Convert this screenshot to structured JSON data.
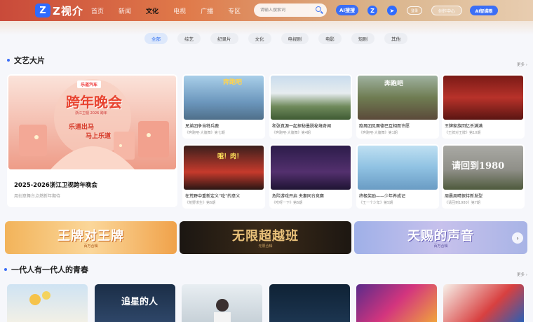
{
  "header": {
    "logo_mark": "Z",
    "logo_text": "Z视介",
    "nav": [
      "首页",
      "新闻",
      "文化",
      "电视",
      "广播",
      "专区"
    ],
    "active_nav": "文化",
    "search_placeholder": "请输入搜索词",
    "ai_search_label": "AI搜搜",
    "login_label": "登录",
    "creator_label": "创作中心",
    "smart_label": "AI智媒眼"
  },
  "filters": [
    "全部",
    "综艺",
    "纪录片",
    "文化",
    "电视剧",
    "电影",
    "短剧",
    "其他"
  ],
  "section1": {
    "title": "文艺大片",
    "more": "更多 ›"
  },
  "feature": {
    "title": "2025-2026浙江卫视跨年晚会",
    "subtitle": "用创意舞台点燃新年期待",
    "poster_brand": "乐道汽车",
    "poster_title": "跨年晚会",
    "poster_date": "浙江卫视 2026 跨年",
    "poster_slogan_1": "乐道出马",
    "poster_slogan_2": "马上乐道"
  },
  "cards": [
    {
      "title": "兄弟团争当特兵鹿",
      "subtitle": "《奔跑吧·大篷舞》第七期",
      "wm": "奔跑吧"
    },
    {
      "title": "和张真源一起探秘墨脱秘境奇闻",
      "subtitle": "《奔跑吧·大篷舞》第4期",
      "wm": ""
    },
    {
      "title": "跑男团见面德巴互相而许愿",
      "subtitle": "《奔跑吧·大篷舞》第1期",
      "wm": "奔跑吧"
    },
    {
      "title": "王牌家族回忆杀满满",
      "subtitle": "《王牌对王牌》第10期",
      "wm": ""
    },
    {
      "title": "在荒野中重新定义“吃”的意义",
      "subtitle": "《荒野求生》第6期",
      "wm": "哦！肉！"
    },
    {
      "title": "危险游戏开启 夫妻同台竞赛",
      "subtitle": "《哎呀一下》第6期",
      "wm": ""
    },
    {
      "title": "终极奖励——少年养成记",
      "subtitle": "《王一个少年》第5期",
      "wm": ""
    },
    {
      "title": "周晨周晴保持新发型",
      "subtitle": "《请回到1980》第7期",
      "wm": "请回到1980"
    }
  ],
  "banners": [
    {
      "title": "王牌对王牌",
      "subtitle": "百万合辑"
    },
    {
      "title": "无限超越班",
      "subtitle": "无限合辑"
    },
    {
      "title": "天赐的声音",
      "subtitle": "百万合辑"
    }
  ],
  "banner_next": "›",
  "section2": {
    "title": "一代人有一代人的青春",
    "more": "更多 ›"
  },
  "posters": [
    {
      "text": ""
    },
    {
      "text": "追星的人"
    },
    {
      "text": ""
    },
    {
      "text": ""
    },
    {
      "text": ""
    },
    {
      "text": ""
    }
  ]
}
